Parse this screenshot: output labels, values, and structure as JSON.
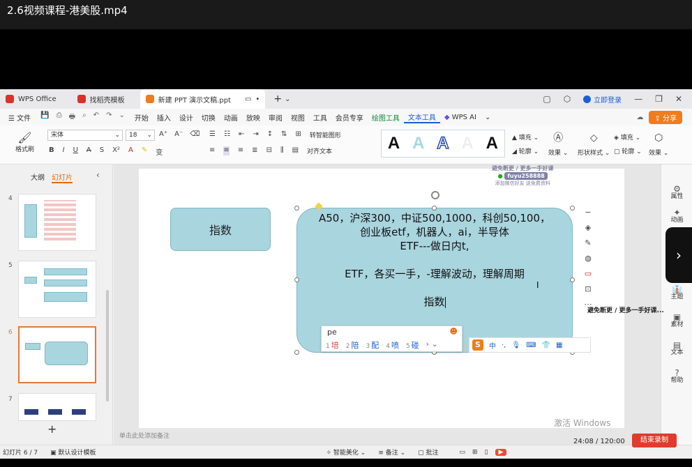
{
  "player": {
    "title": "2.6视频课程-港美股.mp4"
  },
  "tabs": [
    {
      "label": "WPS Office",
      "color": "#d9322b"
    },
    {
      "label": "找稻壳模板",
      "color": "#d9322b"
    },
    {
      "label": "新建 PPT 演示文稿.ppt",
      "color": "#f07c1c"
    }
  ],
  "account": {
    "login": "立即登录"
  },
  "menu": {
    "file": "文件",
    "items": [
      "开始",
      "插入",
      "设计",
      "切换",
      "动画",
      "放映",
      "审阅",
      "视图",
      "工具",
      "会员专享"
    ],
    "drawing_tools": "绘图工具",
    "text_tools": "文本工具",
    "wps_ai": "WPS AI",
    "share": "分享"
  },
  "ribbon": {
    "format_painter": "格式刷",
    "font": "宋体",
    "font_size": "18",
    "convert_smartart": "转智能图形",
    "align_text": "对齐文本",
    "fill": "填充",
    "outline": "轮廓",
    "effects": "效果",
    "shape_style": "形状样式",
    "shape_fill": "填充",
    "shape_outline": "轮廓",
    "shape_effects": "效果"
  },
  "left_panel": {
    "tab_outline": "大纲",
    "tab_slides": "幻灯片",
    "slide_numbers": [
      "4",
      "5",
      "6",
      "7"
    ]
  },
  "slide": {
    "box_small_text": "指数",
    "box_big_lines": [
      "A50，沪深300，中证500,1000，科创50,100，",
      "创业板etf，机器人，ai，半导体",
      "ETF---做日内t,",
      "",
      "ETF，各买一手，-理解波动，理解周期",
      "",
      "指数"
    ],
    "watermark_line1": "避免断更 / 更多一手好课",
    "watermark_id": "fuyu258888",
    "watermark_line3": "添加微信好友 送免费资料"
  },
  "ime": {
    "input": "pe",
    "candidates": [
      {
        "n": "1",
        "c": "培"
      },
      {
        "n": "2",
        "c": "陪"
      },
      {
        "n": "3",
        "c": "配"
      },
      {
        "n": "4",
        "c": "喷"
      },
      {
        "n": "5",
        "c": "碰"
      }
    ],
    "toolbar_mode": "中"
  },
  "notes": {
    "placeholder": "单击此处添加备注"
  },
  "right_panel": {
    "items": [
      "属性",
      "动画",
      "主题",
      "素材",
      "文本",
      "帮助"
    ]
  },
  "status": {
    "slide_counter": "幻灯片 6 / 7",
    "design_template": "默认设计模板",
    "smart_beautify": "智能美化",
    "notes": "备注",
    "comments": "批注"
  },
  "overlay": {
    "watermark2": "避免断更 / 更多一手好课...",
    "activate_windows": "激活 Windows",
    "timer": "24:08 / 120:00",
    "end_button": "结束录制"
  }
}
